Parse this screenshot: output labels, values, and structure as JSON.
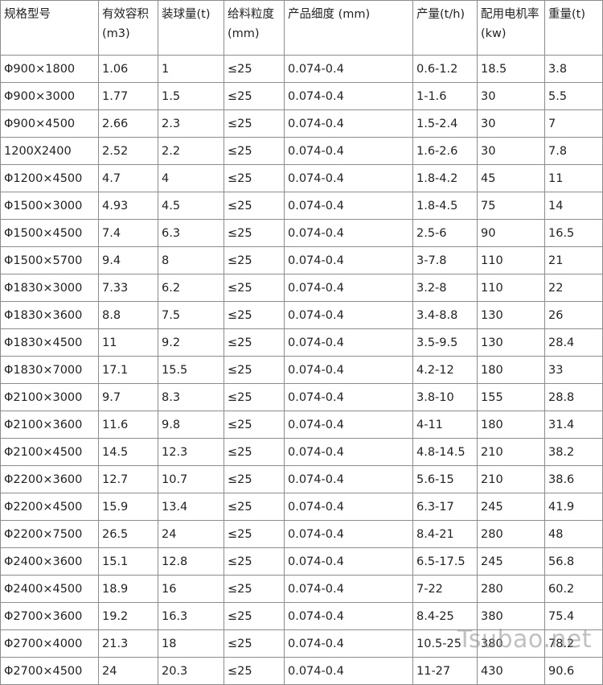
{
  "table": {
    "headers": [
      "规格型号",
      "有效容积(m3)",
      "装球量(t)",
      "给料粒度 (mm)",
      "产品细度 (mm)",
      "产量(t/h)",
      "配用电机率 (kw)",
      "重量(t)"
    ],
    "rows": [
      [
        "Φ900×1800",
        "1.06",
        "1",
        "≤25",
        "0.074-0.4",
        "0.6-1.2",
        "18.5",
        "3.8"
      ],
      [
        "Φ900×3000",
        "1.77",
        "1.5",
        "≤25",
        "0.074-0.4",
        "1-1.6",
        "30",
        "5.5"
      ],
      [
        "Φ900×4500",
        "2.66",
        "2.3",
        "≤25",
        "0.074-0.4",
        "1.5-2.4",
        "30",
        "7"
      ],
      [
        "1200X2400",
        "2.52",
        "2.2",
        "≤25",
        "0.074-0.4",
        "1.6-2.6",
        "30",
        "7.8"
      ],
      [
        "Φ1200×4500",
        "4.7",
        "4",
        "≤25",
        "0.074-0.4",
        "1.8-4.2",
        "45",
        "11"
      ],
      [
        "Φ1500×3000",
        "4.93",
        "4.5",
        "≤25",
        "0.074-0.4",
        "1.8-4.5",
        "75",
        "14"
      ],
      [
        "Φ1500×4500",
        "7.4",
        "6.3",
        "≤25",
        "0.074-0.4",
        "2.5-6",
        "90",
        "16.5"
      ],
      [
        "Φ1500×5700",
        "9.4",
        "8",
        "≤25",
        "0.074-0.4",
        "3-7.8",
        "110",
        "21"
      ],
      [
        "Φ1830×3000",
        "7.33",
        "6.2",
        "≤25",
        "0.074-0.4",
        "3.2-8",
        "110",
        "22"
      ],
      [
        "Φ1830×3600",
        "8.8",
        "7.5",
        "≤25",
        "0.074-0.4",
        "3.4-8.8",
        "130",
        "26"
      ],
      [
        "Φ1830×4500",
        "11",
        "9.2",
        "≤25",
        "0.074-0.4",
        "3.5-9.5",
        "130",
        "28.4"
      ],
      [
        "Φ1830×7000",
        "17.1",
        "15.5",
        "≤25",
        "0.074-0.4",
        "4.2-12",
        "180",
        "33"
      ],
      [
        "Φ2100×3000",
        "9.7",
        "8.3",
        "≤25",
        "0.074-0.4",
        "3.8-10",
        "155",
        "28.8"
      ],
      [
        "Φ2100×3600",
        "11.6",
        "9.8",
        "≤25",
        "0.074-0.4",
        "4-11",
        "180",
        "31.4"
      ],
      [
        "Φ2100×4500",
        "14.5",
        "12.3",
        "≤25",
        "0.074-0.4",
        "4.8-14.5",
        "210",
        "38.2"
      ],
      [
        "Φ2200×3600",
        "12.7",
        "10.7",
        "≤25",
        "0.074-0.4",
        "5.6-15",
        "210",
        "38.6"
      ],
      [
        "Φ2200×4500",
        "15.9",
        "13.4",
        "≤25",
        "0.074-0.4",
        "6.3-17",
        "245",
        "41.9"
      ],
      [
        "Φ2200×7500",
        "26.5",
        "24",
        "≤25",
        "0.074-0.4",
        "8.4-21",
        "280",
        "48"
      ],
      [
        "Φ2400×3600",
        "15.1",
        "12.8",
        "≤25",
        "0.074-0.4",
        "6.5-17.5",
        "245",
        "56.8"
      ],
      [
        "Φ2400×4500",
        "18.9",
        "16",
        "≤25",
        "0.074-0.4",
        "7-22",
        "280",
        "60.2"
      ],
      [
        "Φ2700×3600",
        "19.2",
        "16.3",
        "≤25",
        "0.074-0.4",
        "8.4-25",
        "380",
        "75.4"
      ],
      [
        "Φ2700×4000",
        "21.3",
        "18",
        "≤25",
        "0.074-0.4",
        "10.5-25",
        "380",
        "78.2"
      ],
      [
        "Φ2700×4500",
        "24",
        "20.3",
        "≤25",
        "0.074-0.4",
        "11-27",
        "430",
        "90.6"
      ]
    ]
  },
  "watermark": "Tsubao.net",
  "colors": {
    "border": "#8c8c8c",
    "text": "#222222",
    "watermark": "#8c8c8c"
  }
}
